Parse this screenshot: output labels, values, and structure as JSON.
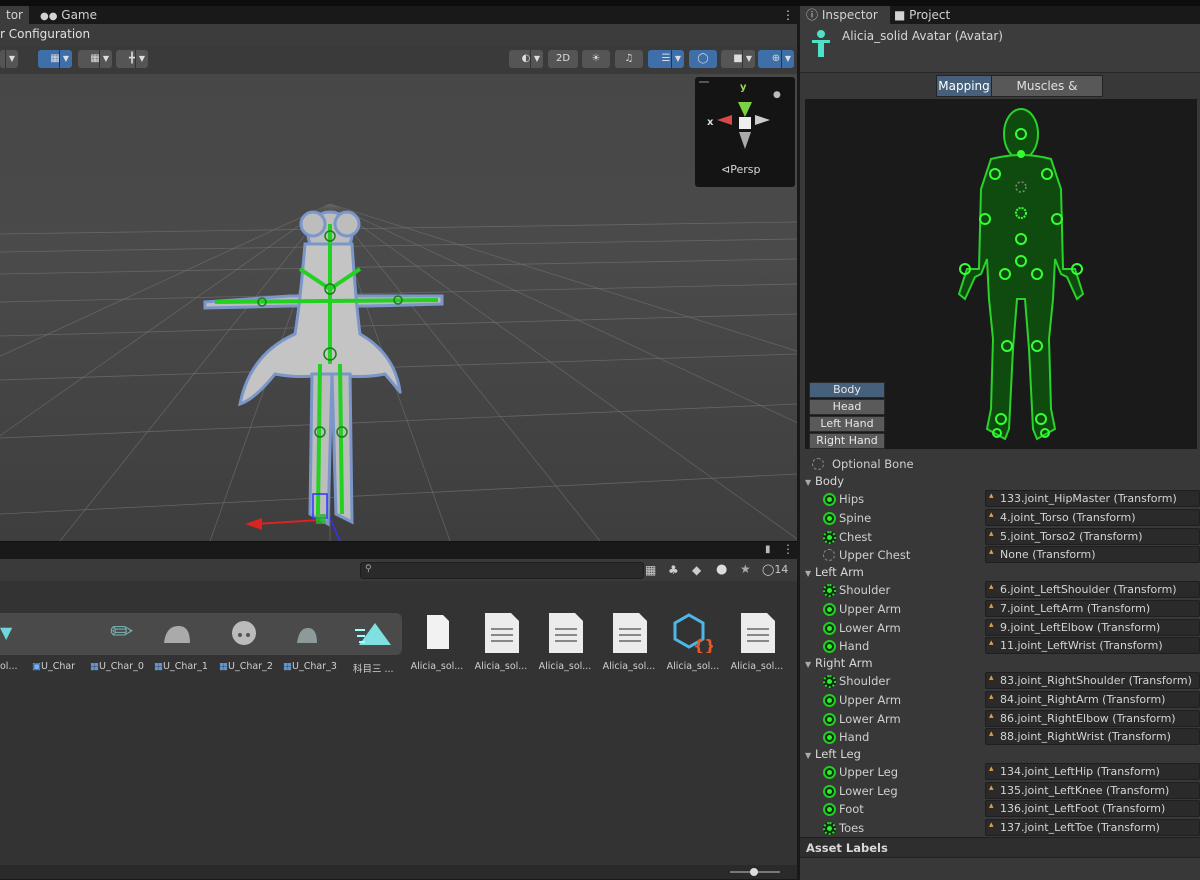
{
  "left_tabs": [
    {
      "label": "tor",
      "active": true
    },
    {
      "label": "Game",
      "active": false
    }
  ],
  "config_title": "r Configuration",
  "toolbar": {
    "btn_2d": "2D",
    "hidden_count": "14"
  },
  "gizmo": {
    "y_label": "y",
    "x_label": "x",
    "persp_label": "⊲Persp"
  },
  "assets": {
    "prefab_labels": [
      "ol...",
      "U_Char",
      "U_Char_0",
      "U_Char_1",
      "U_Char_2",
      "U_Char_3",
      "科目三 ..."
    ],
    "file_labels": [
      "Alicia_sol...",
      "Alicia_sol...",
      "Alicia_sol...",
      "Alicia_sol...",
      "Alicia_sol...",
      "Alicia_sol..."
    ]
  },
  "right_tabs": [
    {
      "label": "Inspector",
      "active": true
    },
    {
      "label": "Project",
      "active": false
    }
  ],
  "inspector": {
    "title": "Alicia_solid Avatar (Avatar)",
    "mode_tabs": [
      "Mapping",
      "Muscles & Settings"
    ],
    "body_buttons": [
      "Body",
      "Head",
      "Left Hand",
      "Right Hand"
    ],
    "optional_bone": "Optional Bone",
    "sections": [
      {
        "name": "Body",
        "rows": [
          {
            "name": "Hips",
            "value": "133.joint_HipMaster (Transform)",
            "state": "ok"
          },
          {
            "name": "Spine",
            "value": "4.joint_Torso (Transform)",
            "state": "ok"
          },
          {
            "name": "Chest",
            "value": "5.joint_Torso2 (Transform)",
            "state": "dotted"
          },
          {
            "name": "Upper Chest",
            "value": "None (Transform)",
            "state": "none"
          }
        ]
      },
      {
        "name": "Left Arm",
        "rows": [
          {
            "name": "Shoulder",
            "value": "6.joint_LeftShoulder (Transform)",
            "state": "dotted"
          },
          {
            "name": "Upper Arm",
            "value": "7.joint_LeftArm (Transform)",
            "state": "ok"
          },
          {
            "name": "Lower Arm",
            "value": "9.joint_LeftElbow (Transform)",
            "state": "ok"
          },
          {
            "name": "Hand",
            "value": "11.joint_LeftWrist (Transform)",
            "state": "ok"
          }
        ]
      },
      {
        "name": "Right Arm",
        "rows": [
          {
            "name": "Shoulder",
            "value": "83.joint_RightShoulder (Transform)",
            "state": "dotted"
          },
          {
            "name": "Upper Arm",
            "value": "84.joint_RightArm (Transform)",
            "state": "ok"
          },
          {
            "name": "Lower Arm",
            "value": "86.joint_RightElbow (Transform)",
            "state": "ok"
          },
          {
            "name": "Hand",
            "value": "88.joint_RightWrist (Transform)",
            "state": "ok"
          }
        ]
      },
      {
        "name": "Left Leg",
        "rows": [
          {
            "name": "Upper Leg",
            "value": "134.joint_LeftHip (Transform)",
            "state": "ok"
          },
          {
            "name": "Lower Leg",
            "value": "135.joint_LeftKnee (Transform)",
            "state": "ok"
          },
          {
            "name": "Foot",
            "value": "136.joint_LeftFoot (Transform)",
            "state": "ok"
          },
          {
            "name": "Toes",
            "value": "137.joint_LeftToe (Transform)",
            "state": "dotted"
          }
        ]
      }
    ],
    "asset_labels": "Asset Labels"
  },
  "colors": {
    "accent_blue": "#46607c",
    "bone_green": "#22d122",
    "panel_bg": "#383838"
  }
}
